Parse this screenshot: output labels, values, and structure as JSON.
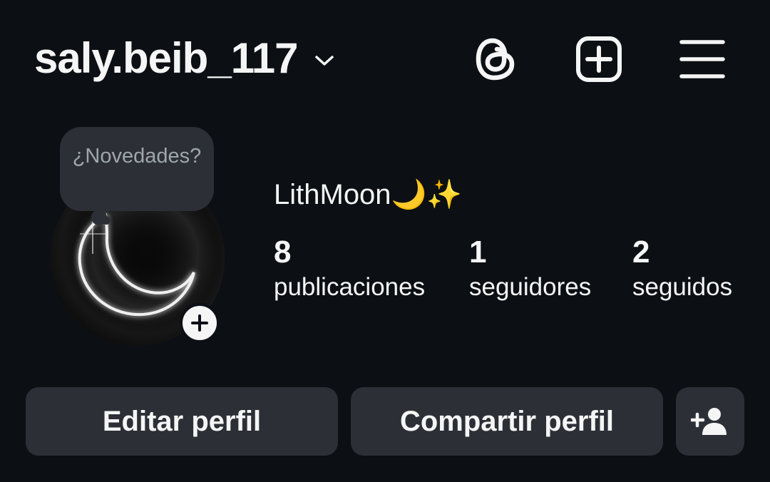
{
  "header": {
    "username": "saly.beib_117",
    "icons": {
      "switch_account": "chevron-down-icon",
      "threads": "threads-icon",
      "new_post": "plus-square-icon",
      "menu": "hamburger-menu-icon"
    }
  },
  "note": {
    "text": "¿Novedades?"
  },
  "profile": {
    "display_name": "LithMoon🌙✨",
    "avatar_icon": "crescent-moon-avatar",
    "add_story_icon": "plus-icon"
  },
  "stats": {
    "posts": {
      "count": "8",
      "label": "publicaciones"
    },
    "followers": {
      "count": "1",
      "label": "seguidores"
    },
    "following": {
      "count": "2",
      "label": "seguidos"
    }
  },
  "buttons": {
    "edit_profile": "Editar perfil",
    "share_profile": "Compartir perfil",
    "discover_people_icon": "person-add-icon"
  },
  "colors": {
    "background": "#0c1014",
    "surface": "#2c3036",
    "text": "#f5f5f5",
    "muted_text": "#a0a6ad"
  }
}
